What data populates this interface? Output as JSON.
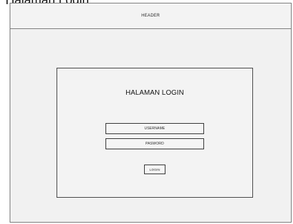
{
  "caption": "Halaman Login",
  "header": {
    "label": "HEADER"
  },
  "login": {
    "title": "HALAMAN LOGIN",
    "username_label": "USERNAME",
    "password_label": "PASWORD",
    "button_label": "LOGIN"
  }
}
